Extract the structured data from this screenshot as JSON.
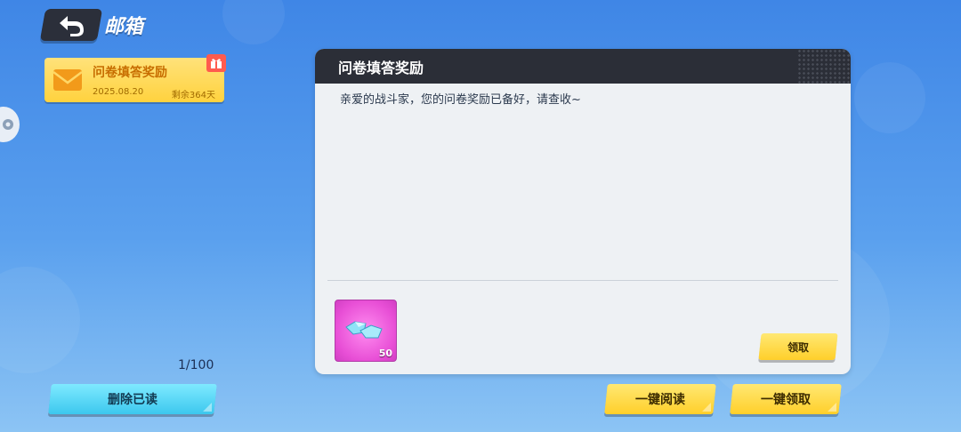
{
  "header": {
    "title": "邮箱"
  },
  "mail_list": [
    {
      "subject": "问卷填答奖励",
      "date": "2025.08.20",
      "remaining": "剩余364天"
    }
  ],
  "footer_left": {
    "page_count": "1/100",
    "delete_read_label": "删除已读"
  },
  "detail": {
    "title": "问卷填答奖励",
    "body": "亲爱的战斗家，您的问卷奖励已备好，请查收~",
    "reward_qty": "50",
    "claim_label": "领取"
  },
  "footer_right": {
    "read_all_label": "一键阅读",
    "claim_all_label": "一键领取"
  },
  "colors": {
    "accent_yellow": "#ffd23e",
    "accent_cyan": "#3cc8ee",
    "panel_header": "#2b2e37"
  },
  "icons": [
    "back-arrow-icon",
    "envelope-icon",
    "gift-icon",
    "gem-icon"
  ]
}
